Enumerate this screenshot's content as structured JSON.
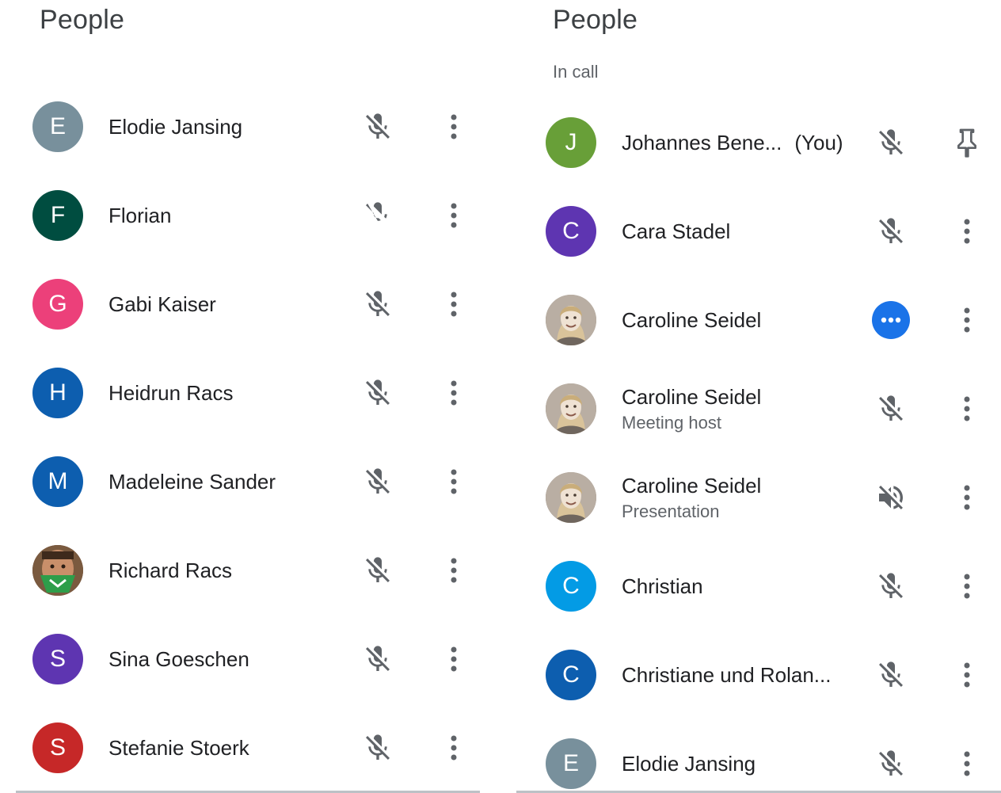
{
  "left_panel": {
    "title": "People",
    "participants": [
      {
        "name": "Elodie Jansing",
        "initial": "E",
        "color": "#78909c"
      },
      {
        "name": "Florian",
        "initial": "F",
        "color": "#004d40"
      },
      {
        "name": "Gabi Kaiser",
        "initial": "G",
        "color": "#ec407a"
      },
      {
        "name": "Heidrun Racs",
        "initial": "H",
        "color": "#0d5eaf"
      },
      {
        "name": "Madeleine Sander",
        "initial": "M",
        "color": "#0d5eaf"
      },
      {
        "name": "Richard Racs",
        "initial": "",
        "color": "#6b4a36"
      },
      {
        "name": "Sina Goeschen",
        "initial": "S",
        "color": "#5e35b1"
      },
      {
        "name": "Stefanie Stoerk",
        "initial": "S",
        "color": "#c62828"
      }
    ]
  },
  "right_panel": {
    "title": "People",
    "section_label": "In call",
    "participants": [
      {
        "name": "Johannes Bene...",
        "you_label": "(You)",
        "initial": "J",
        "color": "#689f38"
      },
      {
        "name": "Cara Stadel",
        "initial": "C",
        "color": "#5e35b1"
      },
      {
        "name": "Caroline Seidel",
        "initial": "",
        "color": "#9e9186"
      },
      {
        "name": "Caroline Seidel",
        "subtitle": "Meeting host",
        "initial": "",
        "color": "#9e9186"
      },
      {
        "name": "Caroline Seidel",
        "subtitle": "Presentation",
        "initial": "",
        "color": "#9e9186"
      },
      {
        "name": "Christian",
        "initial": "C",
        "color": "#039be5"
      },
      {
        "name": "Christiane und Rolan...",
        "initial": "C",
        "color": "#0d5eaf"
      },
      {
        "name": "Elodie Jansing",
        "initial": "E",
        "color": "#78909c"
      }
    ]
  },
  "colors": {
    "speaking_accent": "#1a73e8",
    "icon_gray": "#5f6368"
  },
  "icons": {
    "mic": "mic-off-icon",
    "audio": "volume-off-icon",
    "more": "more-vert-icon",
    "pin": "pin-icon",
    "speaking": "speaking-indicator-icon"
  }
}
